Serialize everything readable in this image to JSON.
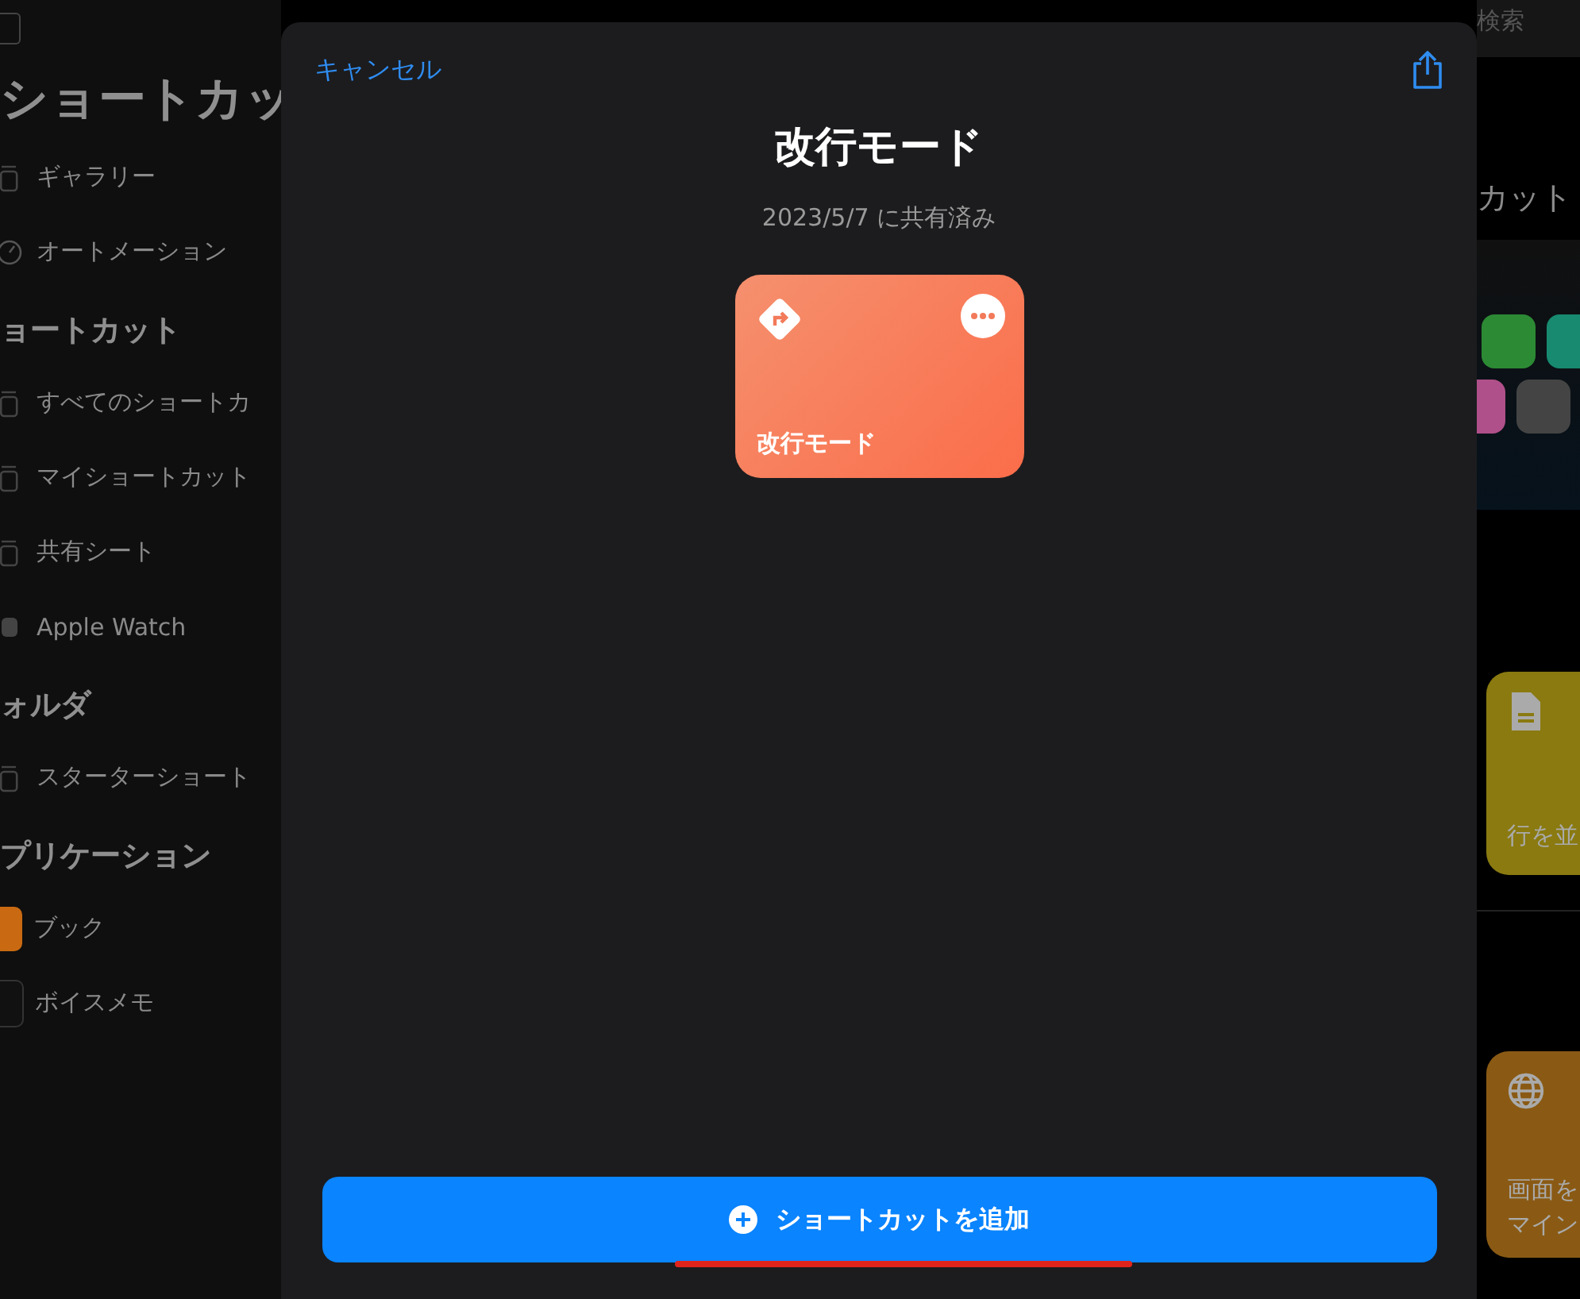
{
  "sidebar": {
    "title": "ショートカッ",
    "groups": [
      {
        "items": [
          {
            "label": "ギャラリー",
            "kind": "gallery"
          },
          {
            "label": "オートメーション",
            "kind": "automation"
          }
        ]
      },
      {
        "heading": "ョートカット",
        "items": [
          {
            "label": "すべてのショートカ",
            "kind": "stack"
          },
          {
            "label": "マイショートカット",
            "kind": "stack"
          },
          {
            "label": "共有シート",
            "kind": "share"
          },
          {
            "label": "Apple Watch",
            "kind": "watch"
          }
        ]
      },
      {
        "heading": "ォルダ",
        "items": [
          {
            "label": "スターターショート",
            "kind": "folder"
          }
        ]
      },
      {
        "heading": "プリケーション",
        "items": [
          {
            "label": "ブック",
            "kind": "book"
          },
          {
            "label": "ボイスメモ",
            "kind": "voice"
          }
        ]
      }
    ]
  },
  "modal": {
    "cancel": "キャンセル",
    "title": "改行モード",
    "subtitle": "2023/5/7 に共有済み",
    "tile": {
      "label": "改行モード"
    },
    "add_button": "ショートカットを追加"
  },
  "background": {
    "search_placeholder": "検索",
    "heading": "カット",
    "cards": [
      {
        "label_lines": [
          "行を並"
        ],
        "kind": "document",
        "color": "#8a7a10"
      },
      {
        "label_lines": [
          "画面を",
          "マイン"
        ],
        "kind": "globe",
        "color": "#8a5a14"
      }
    ]
  }
}
